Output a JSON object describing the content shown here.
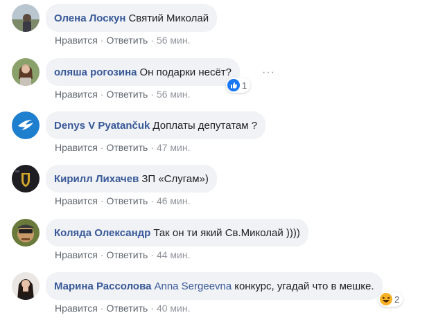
{
  "actions": {
    "like": "Нравится",
    "reply": "Ответить",
    "separator": "·"
  },
  "comments": [
    {
      "author": "Олена Лоскун",
      "mention": "",
      "text": "Святий Миколай",
      "time": "56 мин.",
      "reaction_count": ""
    },
    {
      "author": "оляша рогозина",
      "mention": "",
      "text": "Он подарки несёт?",
      "time": "56 мин.",
      "reaction_count": "1",
      "reaction_icon": "like-icon"
    },
    {
      "author": "Denys V Pyatančuk",
      "mention": "",
      "text": "Доплаты депутатам ?",
      "time": "47 мин.",
      "reaction_count": ""
    },
    {
      "author": "Кирилл Лихачев",
      "mention": "",
      "text": "ЗП «Слугам»)",
      "time": "46 мин.",
      "reaction_count": ""
    },
    {
      "author": "Коляда Олександр",
      "mention": "",
      "text": "Так он ти який Св.Миколай ))))",
      "time": "44 мин.",
      "reaction_count": ""
    },
    {
      "author": "Марина Рассолова",
      "mention": "Anna Sergeevna",
      "text": "конкурс, угадай что в мешке.",
      "time": "40 мин.",
      "reaction_count": "2",
      "reaction_icon": "haha-icon"
    }
  ],
  "more_options": "···",
  "colors": {
    "bubble_bg": "#f0f2f5",
    "author": "#385898",
    "meta": "#606770",
    "like_blue": "#1877f2",
    "haha_yellow": "#f7b125"
  }
}
